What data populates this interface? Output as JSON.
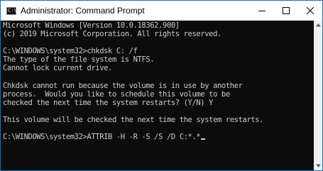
{
  "window": {
    "title": "Administrator: Command Prompt",
    "app_icon_glyph": "C:\\",
    "icons": {
      "app": "command-prompt-icon",
      "minimize": "minimize-icon",
      "maximize": "maximize-icon",
      "close": "close-icon",
      "scroll_up": "scroll-up-arrow-icon",
      "scroll_down": "scroll-down-arrow-icon"
    }
  },
  "console": {
    "background": "#0c0c0c",
    "foreground": "#cccccc",
    "lines": [
      "Microsoft Windows [Version 10.0.18362.900]",
      "(c) 2019 Microsoft Corporation. All rights reserved.",
      "",
      "C:\\WINDOWS\\system32>chkdsk C: /f",
      "The type of the file system is NTFS.",
      "Cannot lock current drive.",
      "",
      "Chkdsk cannot run because the volume is in use by another",
      "process.  Would you like to schedule this volume to be",
      "checked the next time the system restarts? (Y/N) Y",
      "",
      "This volume will be checked the next time the system restarts.",
      "",
      "C:\\WINDOWS\\system32>ATTRIB -H -R -S /S /D C:*.*"
    ]
  }
}
